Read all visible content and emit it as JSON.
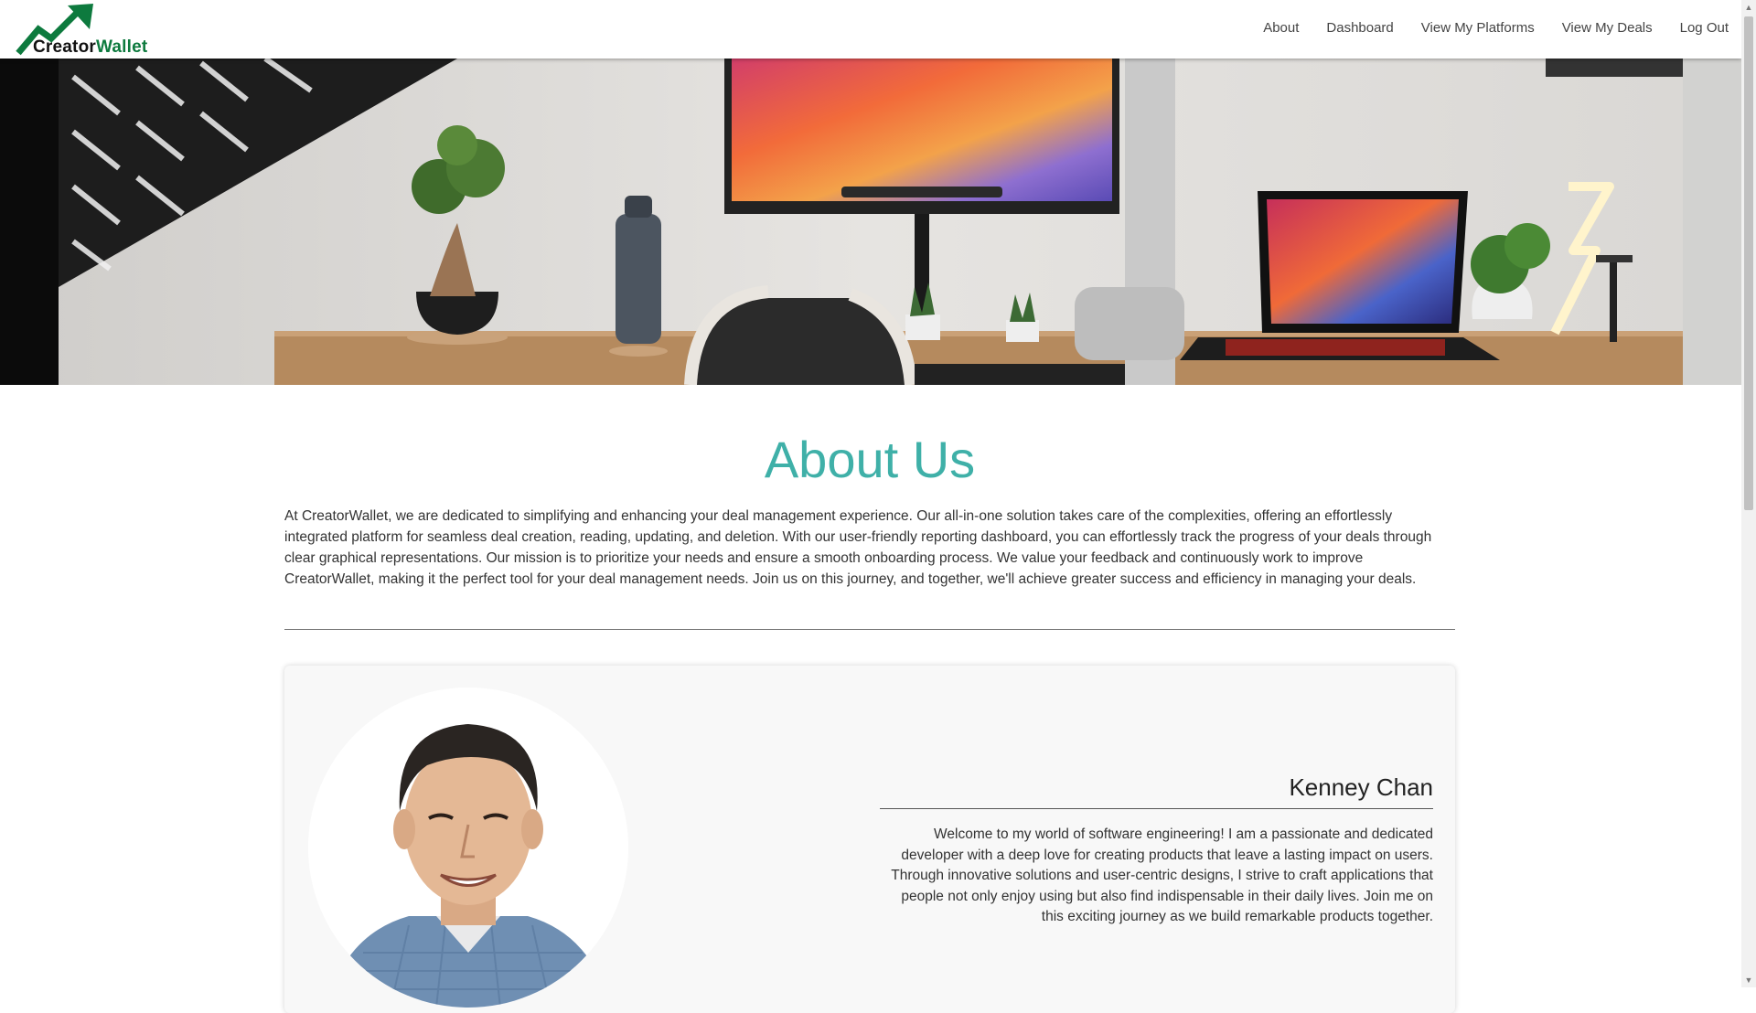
{
  "navbar": {
    "logo_text_main": "Creator",
    "logo_text_accent": "Wallet",
    "links": [
      "About",
      "Dashboard",
      "View My Platforms",
      "View My Deals",
      "Log Out"
    ]
  },
  "about": {
    "title": "About Us",
    "description": "At CreatorWallet, we are dedicated to simplifying and enhancing your deal management experience. Our all-in-one solution takes care of the complexities, offering an effortlessly integrated platform for seamless deal creation, reading, updating, and deletion. With our user-friendly reporting dashboard, you can effortlessly track the progress of your deals through clear graphical representations. Our mission is to prioritize your needs and ensure a smooth onboarding process. We value your feedback and continuously work to improve CreatorWallet, making it the perfect tool for your deal management needs. Join us on this journey, and together, we'll achieve greater success and efficiency in managing your deals."
  },
  "team": [
    {
      "name": "Kenney Chan",
      "bio": "Welcome to my world of software engineering! I am a passionate and dedicated developer with a deep love for creating products that leave a lasting impact on users. Through innovative solutions and user-centric designs, I strive to craft applications that people not only enjoy using but also find indispensable in their daily lives. Join me on this exciting journey as we build remarkable products together."
    }
  ],
  "colors": {
    "accent_teal": "#3fb0a8",
    "brand_green": "#0d7a3e"
  },
  "icons": {
    "logo": "upward-trend-arrow-icon",
    "scroll_up": "triangle-up-icon",
    "scroll_down": "triangle-down-icon"
  }
}
